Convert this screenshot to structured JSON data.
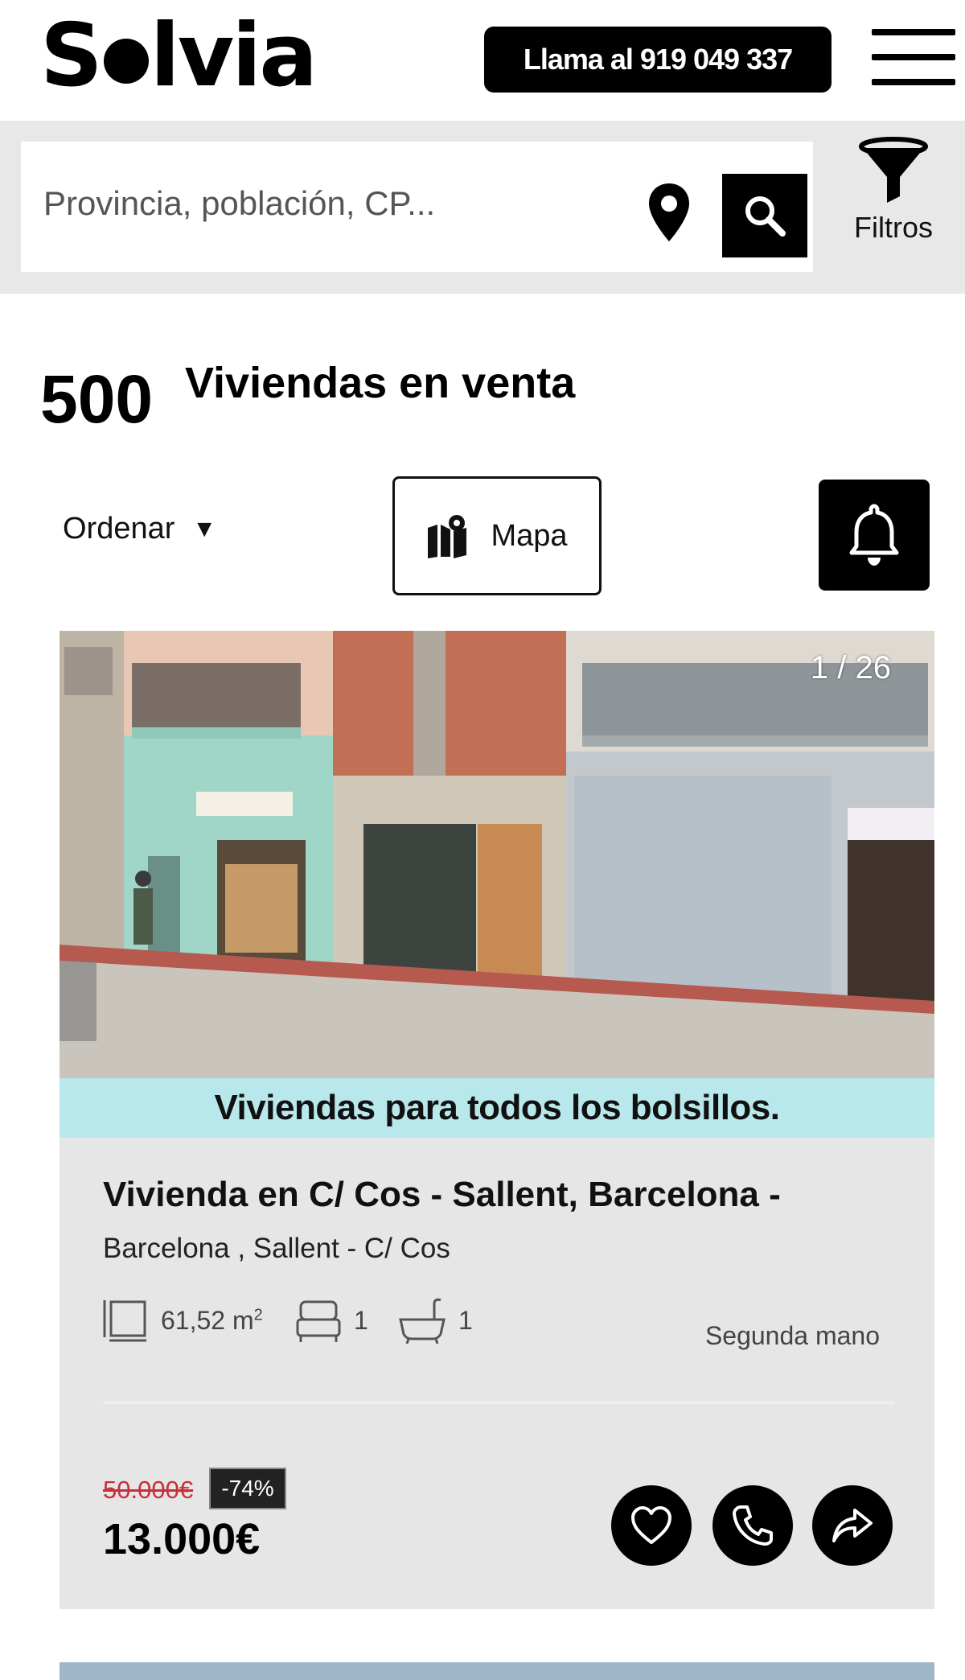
{
  "header": {
    "logo": "Solvia",
    "call_label": "Llama al 919 049 337",
    "menu_icon": "hamburger-icon"
  },
  "search": {
    "placeholder": "Provincia, población, CP...",
    "location_icon": "location-pin-icon",
    "search_icon": "search-icon",
    "filters_label": "Filtros",
    "filters_icon": "funnel-icon"
  },
  "results": {
    "count": "500",
    "label": "Viviendas en venta"
  },
  "toolbar": {
    "order_label": "Ordenar",
    "order_caret": "▼",
    "map_label": "Mapa",
    "alert_icon": "bell-icon"
  },
  "listing": {
    "image_counter": "1 / 26",
    "banner": "Viviendas para todos los bolsillos.",
    "title": "Vivienda en C/ Cos - Sallent, Barcelona -",
    "subtitle": "Barcelona , Sallent - C/ Cos",
    "area": "61,52 m",
    "area_sup": "2",
    "rooms": "1",
    "baths": "1",
    "condition": "Segunda mano",
    "old_price": "50.000€",
    "discount": "-74%",
    "price": "13.000€"
  },
  "colors": {
    "brand": "#000000",
    "banner_bg": "#b9e8ec",
    "card_bg": "#e6e6e6",
    "old_price": "#c8303a"
  }
}
